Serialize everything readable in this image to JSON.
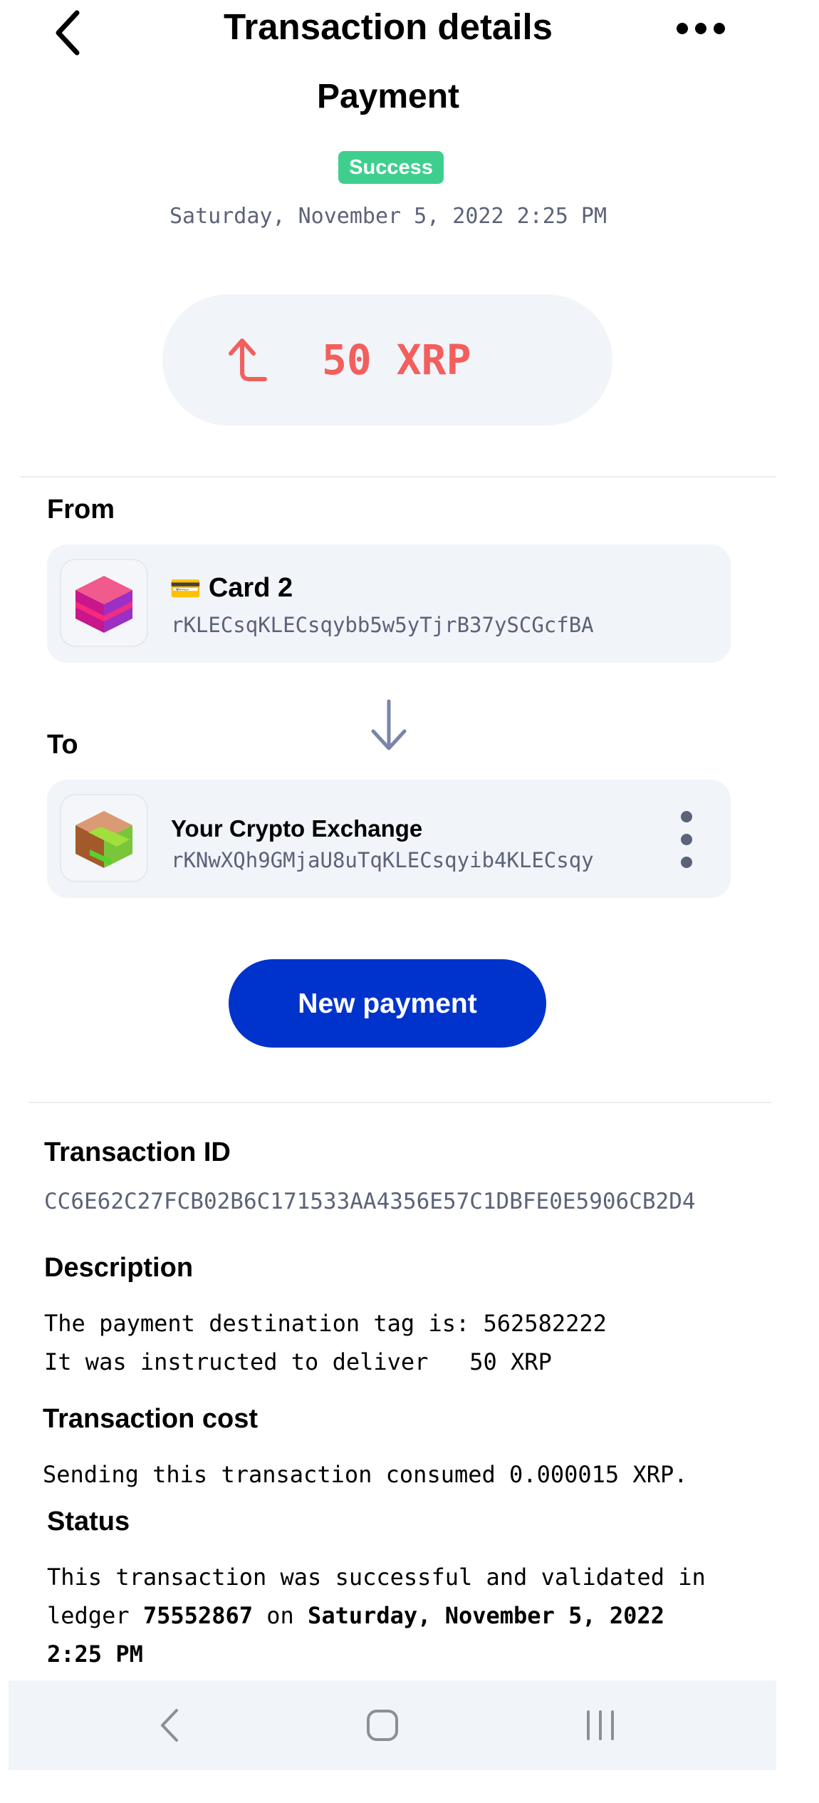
{
  "header": {
    "title": "Transaction details"
  },
  "payment": {
    "type": "Payment",
    "status_badge": "Success",
    "datetime": "Saturday, November 5, 2022 2:25 PM",
    "amount": "50 XRP"
  },
  "from": {
    "label": "From",
    "account_emoji": "💳",
    "account_name": "Card 2",
    "address": "rKLECsqKLECsqybb5w5yTjrB37ySCGcfBA"
  },
  "to": {
    "label": "To",
    "account_name": "Your Crypto Exchange",
    "address": "rKNwXQh9GMjaU8uTqKLECsqyib4KLECsqy"
  },
  "actions": {
    "new_payment": "New payment"
  },
  "details": {
    "transaction_id_label": "Transaction ID",
    "transaction_id": "CC6E62C27FCB02B6C171533AA4356E57C1DBFE0E5906CB2D4",
    "description_label": "Description",
    "description_line1": "The payment destination tag is: 562582222",
    "description_line2": "It was instructed to deliver   50 XRP",
    "cost_label": "Transaction cost",
    "cost_text": "Sending this transaction consumed 0.000015 XRP.",
    "status_label": "Status",
    "status_text_1": "This transaction was successful and validated in",
    "status_text_2a": "ledger ",
    "status_ledger": "75552867",
    "status_text_2b": " on ",
    "status_date": "Saturday, November 5, 2022",
    "status_time": "2:25 PM"
  },
  "colors": {
    "success": "#3ecf8e",
    "amount_out": "#f25f5c",
    "primary_button": "#0033cc",
    "card_bg": "#f1f4f9"
  },
  "icons": [
    "back-arrow-icon",
    "more-options-icon",
    "outgoing-arrow-icon",
    "card-emoji-icon",
    "down-arrow-icon",
    "kebab-menu-icon",
    "nav-back-icon",
    "nav-home-icon",
    "nav-recents-icon"
  ]
}
